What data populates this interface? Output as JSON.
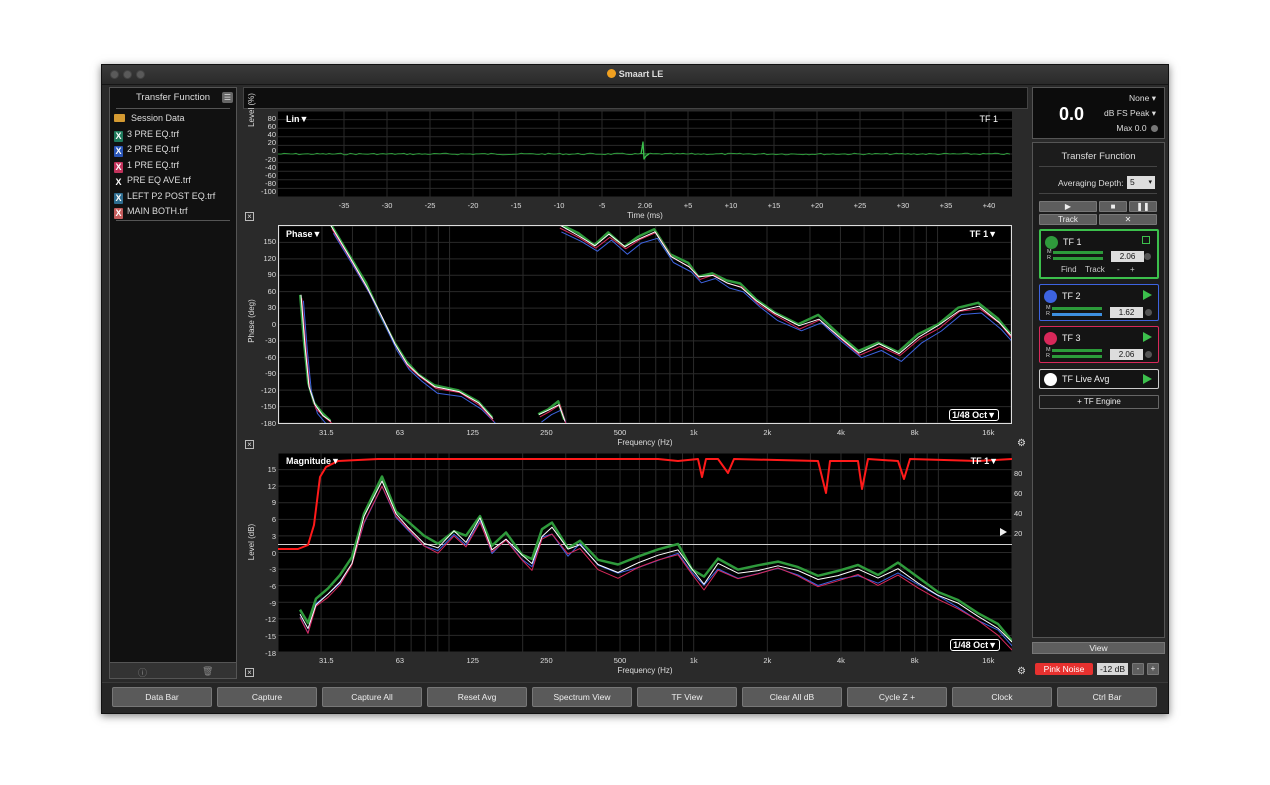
{
  "window": {
    "title": "Smaart LE"
  },
  "left_panel": {
    "header": "Transfer Function",
    "items": [
      {
        "label": "Session Data",
        "kind": "folder",
        "color": "#d49a32"
      },
      {
        "label": "3 PRE EQ.trf",
        "kind": "file",
        "color": "#1f7a5c"
      },
      {
        "label": "2 PRE EQ.trf",
        "kind": "file",
        "color": "#2a56b8"
      },
      {
        "label": "1 PRE EQ.trf",
        "kind": "file",
        "color": "#c2335c"
      },
      {
        "label": "PRE EQ AVE.trf",
        "kind": "file",
        "color": "#111111"
      },
      {
        "label": "LEFT P2 POST EQ.trf",
        "kind": "file",
        "color": "#2d6c8f"
      },
      {
        "label": "MAIN BOTH.trf",
        "kind": "file",
        "color": "#c45b5b"
      }
    ]
  },
  "impulse_plot": {
    "mode_label": "Lin▼",
    "tf_label": "TF 1",
    "ylabel": "Level (%)",
    "xlabel": "Time (ms)",
    "y_ticks": [
      "80",
      "60",
      "40",
      "20",
      "0",
      "-20",
      "-40",
      "-60",
      "-80",
      "-100"
    ],
    "x_ticks": [
      "-35",
      "-30",
      "-25",
      "-20",
      "-15",
      "-10",
      "-5",
      "2.06",
      "+5",
      "+10",
      "+15",
      "+20",
      "+25",
      "+30",
      "+35",
      "+40"
    ]
  },
  "phase_plot": {
    "mode_label": "Phase▼",
    "tf_label": "TF 1▼",
    "resolution": "1/48 Oct▼",
    "ylabel": "Phase (deg)",
    "xlabel": "Frequency (Hz)",
    "y_ticks": [
      "150",
      "120",
      "90",
      "60",
      "30",
      "0",
      "-30",
      "-60",
      "-90",
      "-120",
      "-150",
      "-180"
    ],
    "x_ticks": [
      "31.5",
      "63",
      "125",
      "250",
      "500",
      "1k",
      "2k",
      "4k",
      "8k",
      "16k"
    ]
  },
  "magnitude_plot": {
    "mode_label": "Magnitude▼",
    "tf_label": "TF 1▼",
    "resolution": "1/48 Oct▼",
    "ylabel": "Level (dB)",
    "xlabel": "Frequency (Hz)",
    "y_ticks": [
      "15",
      "12",
      "9",
      "6",
      "3",
      "0",
      "-3",
      "-6",
      "-9",
      "-12",
      "-15",
      "-18"
    ],
    "coherence_ticks": [
      "80",
      "60",
      "40",
      "20"
    ],
    "x_ticks": [
      "31.5",
      "63",
      "125",
      "250",
      "500",
      "1k",
      "2k",
      "4k",
      "8k",
      "16k"
    ]
  },
  "meter": {
    "value": "0.0",
    "source": "None",
    "mode": "dB FS Peak",
    "max": "Max 0.0"
  },
  "tf_panel": {
    "title": "Transfer Function",
    "averaging_label": "Averaging Depth:",
    "averaging_value": "5",
    "track_label": "Track",
    "find_label": "Find",
    "track2_label": "Track",
    "minus": "-",
    "plus": "+",
    "engines": [
      {
        "name": "TF 1",
        "color": "#2f9a3c",
        "delay": "2.06"
      },
      {
        "name": "TF 2",
        "color": "#3d63e0",
        "delay": "1.62"
      },
      {
        "name": "TF 3",
        "color": "#d8285a",
        "delay": "2.06"
      },
      {
        "name": "TF Live Avg",
        "color": "#ffffff"
      }
    ],
    "add_engine": "+ TF Engine"
  },
  "view_button": "View",
  "pink_noise": {
    "label": "Pink Noise",
    "level": "-12 dB",
    "minus": "-",
    "plus": "+"
  },
  "bottom_buttons": [
    "Data Bar",
    "Capture",
    "Capture All",
    "Reset Avg",
    "Spectrum View",
    "TF View",
    "Clear All dB",
    "Cycle Z +",
    "Clock",
    "Ctrl Bar"
  ],
  "colors": {
    "tf1": "#2f9a3c",
    "tf2": "#3d63e0",
    "tf3": "#d8285a",
    "avg": "#ffffff",
    "coherence": "#ff1a1a"
  }
}
